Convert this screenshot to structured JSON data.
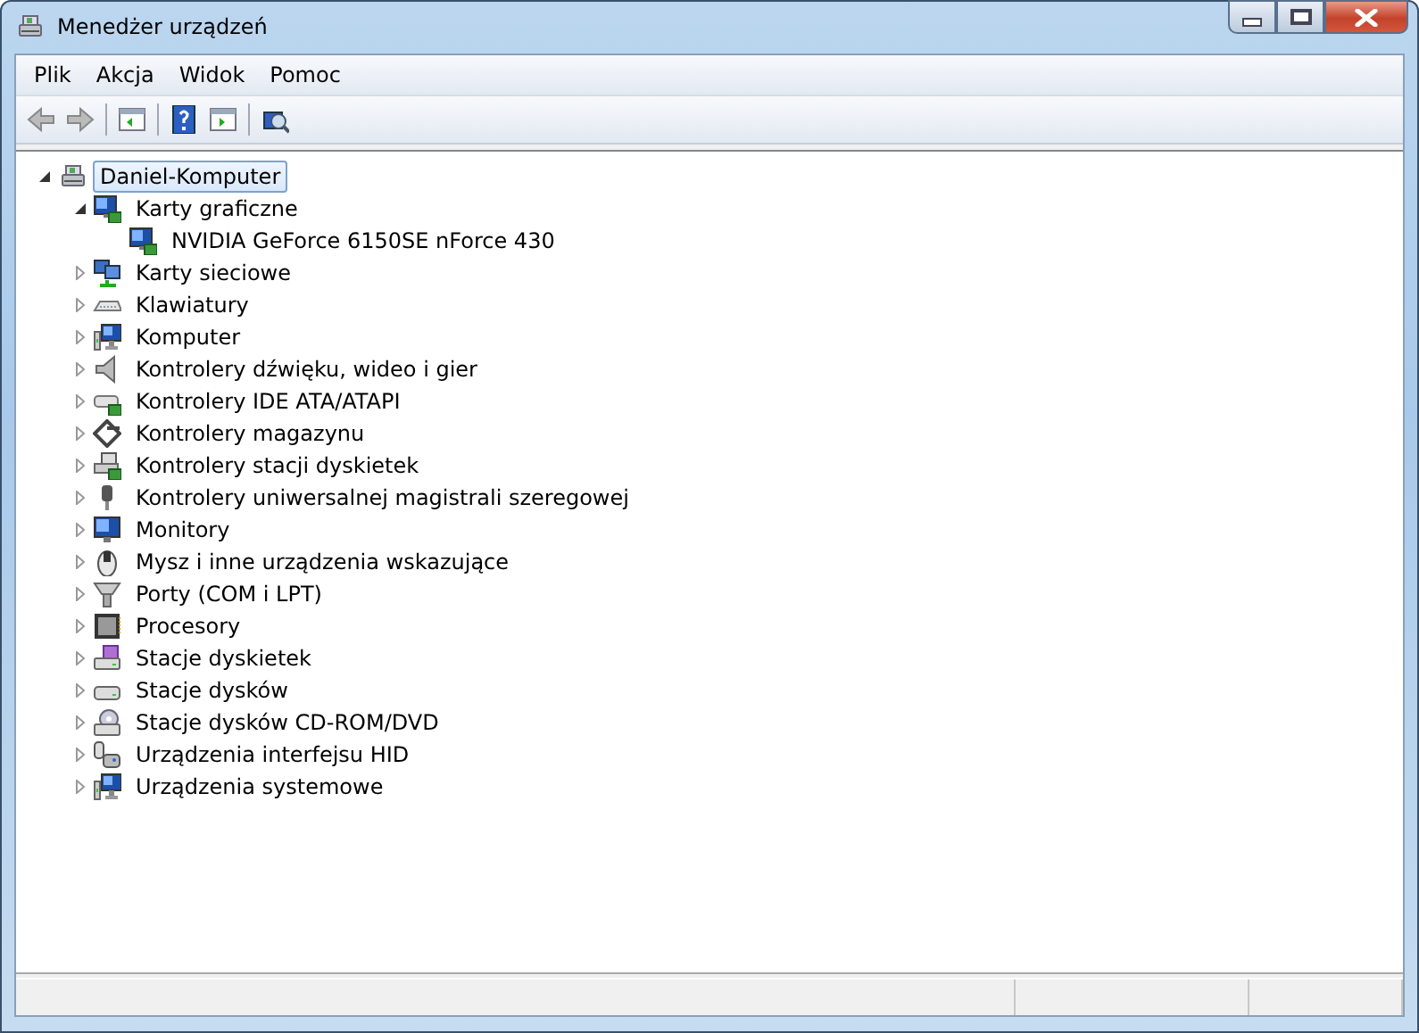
{
  "window": {
    "title": "Menedżer urządzeń"
  },
  "menu": [
    "Plik",
    "Akcja",
    "Widok",
    "Pomoc"
  ],
  "tree": [
    {
      "label": "Daniel-Komputer",
      "selected": true,
      "expanded": true,
      "children": [
        {
          "label": "Karty graficzne",
          "selected": false,
          "expanded": true,
          "children": [
            {
              "label": "NVIDIA GeForce 6150SE nForce 430",
              "selected": false
            }
          ]
        },
        {
          "label": "Karty sieciowe",
          "selected": false,
          "expanded": false
        },
        {
          "label": "Klawiatury",
          "selected": false,
          "expanded": false
        },
        {
          "label": "Komputer",
          "selected": false,
          "expanded": false
        },
        {
          "label": "Kontrolery dźwięku, wideo i gier",
          "selected": false,
          "expanded": false
        },
        {
          "label": "Kontrolery IDE ATA/ATAPI",
          "selected": false,
          "expanded": false
        },
        {
          "label": "Kontrolery magazynu",
          "selected": false,
          "expanded": false
        },
        {
          "label": "Kontrolery stacji dyskietek",
          "selected": false,
          "expanded": false
        },
        {
          "label": "Kontrolery uniwersalnej magistrali szeregowej",
          "selected": false,
          "expanded": false
        },
        {
          "label": "Monitory",
          "selected": false,
          "expanded": false
        },
        {
          "label": "Mysz i inne urządzenia wskazujące",
          "selected": false,
          "expanded": false
        },
        {
          "label": "Porty (COM i LPT)",
          "selected": false,
          "expanded": false
        },
        {
          "label": "Procesory",
          "selected": false,
          "expanded": false
        },
        {
          "label": "Stacje dyskietek",
          "selected": false,
          "expanded": false
        },
        {
          "label": "Stacje dysków",
          "selected": false,
          "expanded": false
        },
        {
          "label": "Stacje dysków CD-ROM/DVD",
          "selected": false,
          "expanded": false
        },
        {
          "label": "Urządzenia interfejsu HID",
          "selected": false,
          "expanded": false
        },
        {
          "label": "Urządzenia systemowe",
          "selected": false,
          "expanded": false
        }
      ]
    }
  ]
}
